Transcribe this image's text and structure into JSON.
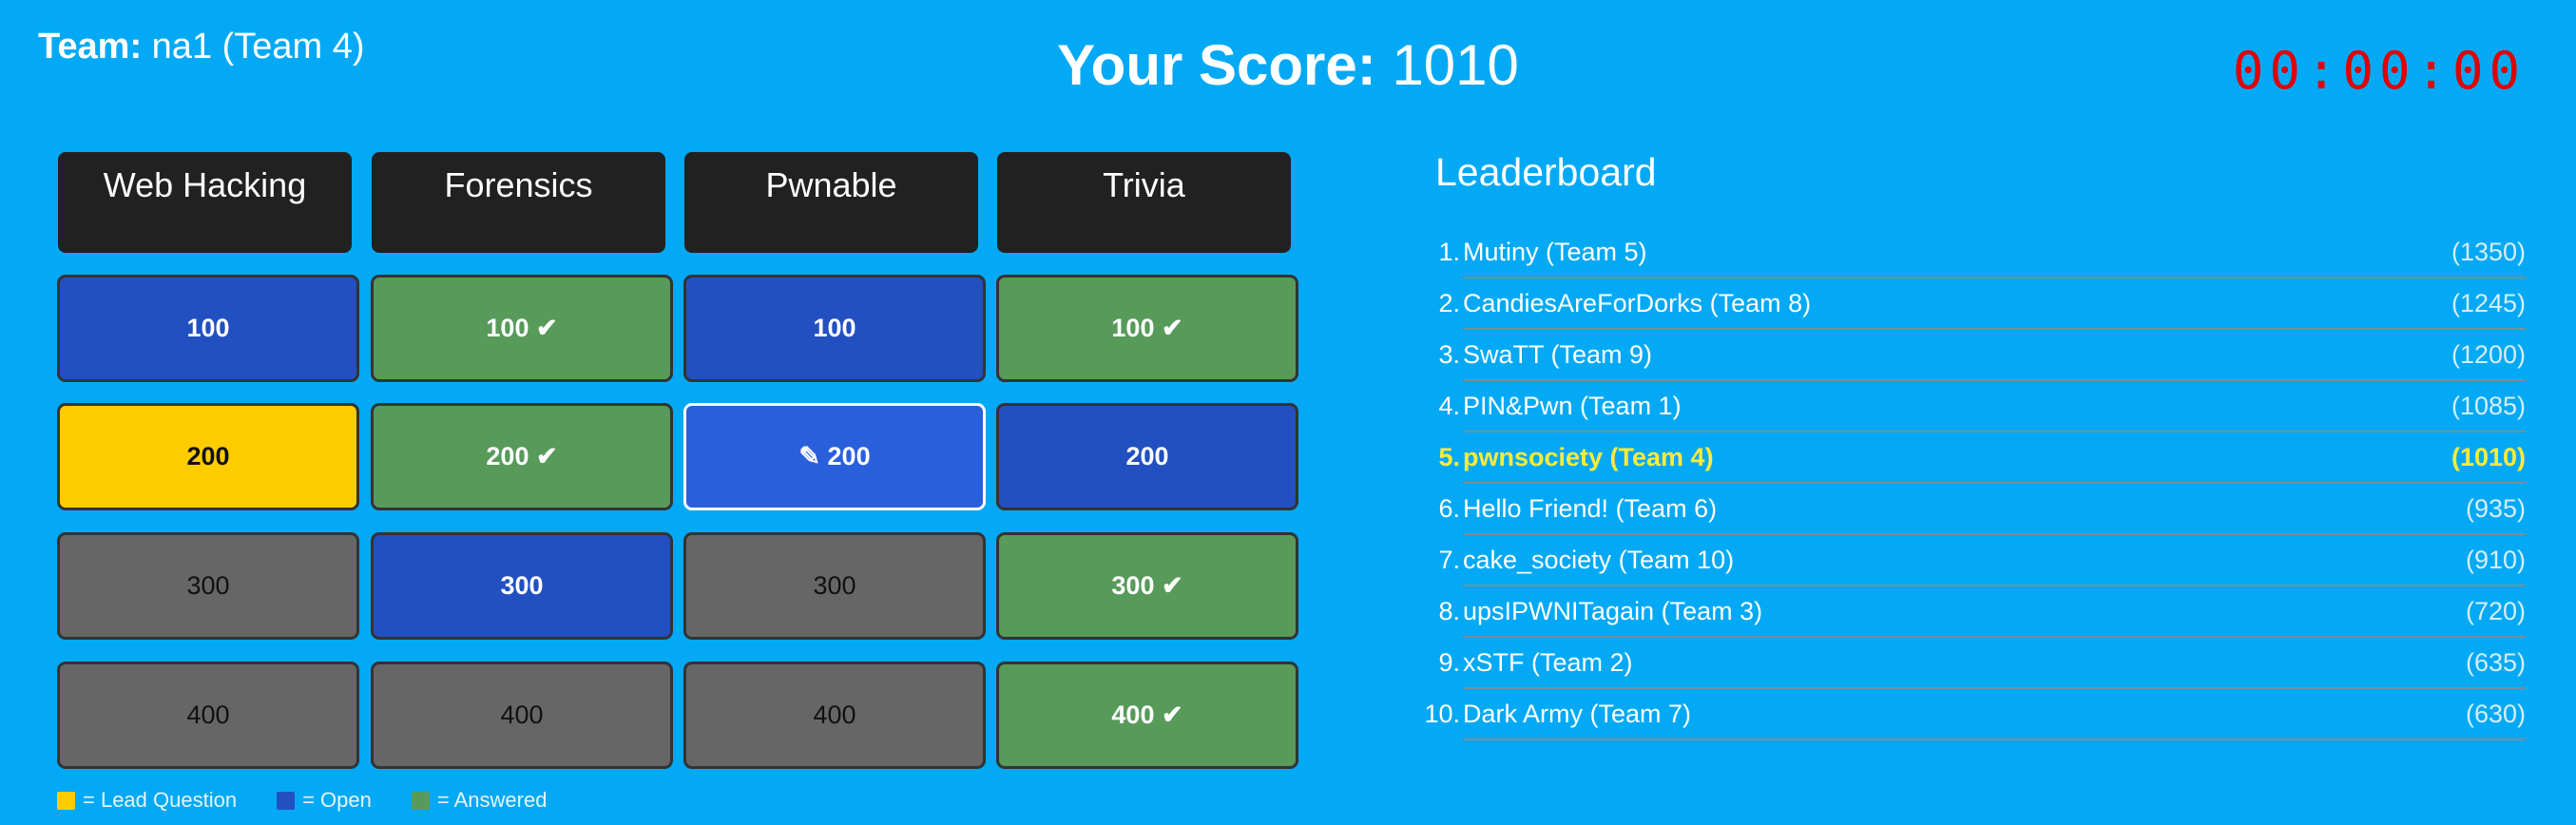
{
  "team": {
    "label": "Team:",
    "name": "na1 (Team 4)"
  },
  "score": {
    "label": "Your Score:",
    "value": "1010"
  },
  "timer": "00:00:00",
  "board": {
    "categories": [
      "Web Hacking",
      "Forensics",
      "Pwnable",
      "Trivia"
    ],
    "tiles": [
      [
        "100",
        "100 ✔",
        "100",
        "100 ✔"
      ],
      [
        "200",
        "200 ✔",
        "✎ 200",
        "200"
      ],
      [
        "300",
        "300",
        "300",
        "300 ✔"
      ],
      [
        "400",
        "400",
        "400",
        "400 ✔"
      ]
    ],
    "tile_states": [
      [
        "open",
        "answered",
        "open",
        "answered"
      ],
      [
        "lead",
        "answered",
        "selected",
        "open"
      ],
      [
        "locked",
        "open",
        "locked",
        "answered"
      ],
      [
        "locked",
        "locked",
        "locked",
        "answered"
      ]
    ]
  },
  "legend": {
    "lead": "= Lead Question",
    "open": "= Open",
    "answered": "= Answered"
  },
  "colors": {
    "background": "#03a9f4",
    "open": "#2250c0",
    "answered": "#579a5a",
    "lead": "#ffcc00",
    "locked": "#666666",
    "header": "#212121",
    "timer": "#e00000",
    "highlight": "#ffeb3b"
  },
  "leaderboard": {
    "title": "Leaderboard",
    "entries": [
      {
        "rank": "1.",
        "name": "Mutiny (Team 5)",
        "score": "(1350)"
      },
      {
        "rank": "2.",
        "name": "CandiesAreForDorks (Team 8)",
        "score": "(1245)"
      },
      {
        "rank": "3.",
        "name": "SwaTT (Team 9)",
        "score": "(1200)"
      },
      {
        "rank": "4.",
        "name": "PIN&Pwn (Team 1)",
        "score": "(1085)"
      },
      {
        "rank": "5.",
        "name": "pwnsociety (Team 4)",
        "score": "(1010)",
        "current": true
      },
      {
        "rank": "6.",
        "name": "Hello Friend! (Team 6)",
        "score": "(935)"
      },
      {
        "rank": "7.",
        "name": "cake_society (Team 10)",
        "score": "(910)"
      },
      {
        "rank": "8.",
        "name": "upsIPWNITagain (Team 3)",
        "score": "(720)"
      },
      {
        "rank": "9.",
        "name": "xSTF (Team 2)",
        "score": "(635)"
      },
      {
        "rank": "10.",
        "name": "Dark Army (Team 7)",
        "score": "(630)"
      }
    ]
  }
}
